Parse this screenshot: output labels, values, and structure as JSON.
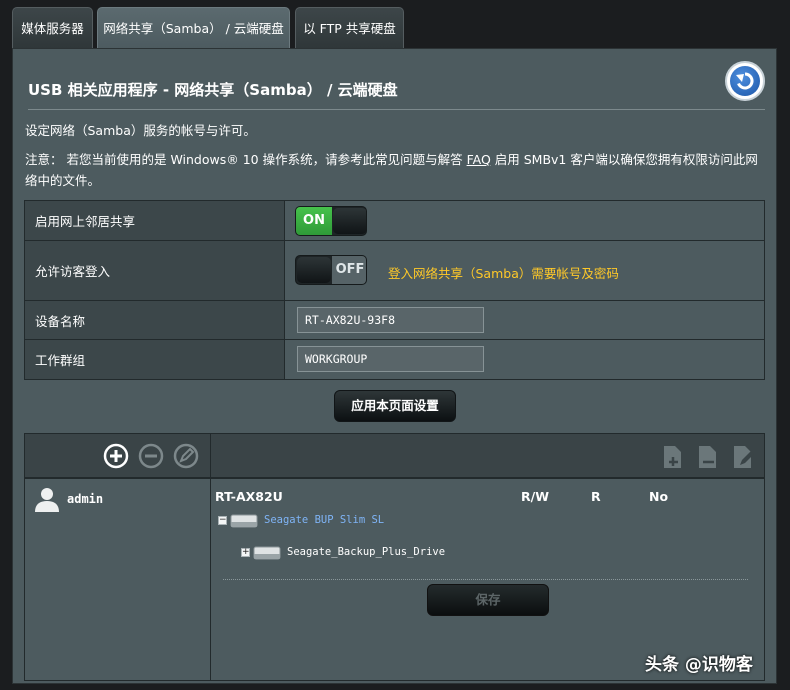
{
  "tabs": [
    {
      "label": "媒体服务器"
    },
    {
      "label": "网络共享（Samba） / 云端硬盘"
    },
    {
      "label": "以 FTP 共享硬盘"
    }
  ],
  "page": {
    "title": "USB 相关应用程序 - 网络共享（Samba） / 云端硬盘",
    "description": "设定网络（Samba）服务的帐号与许可。",
    "note_prefix": "注意： 若您当前使用的是 Windows® 10 操作系统，请参考此常见问题与解答 ",
    "note_faq": "FAQ",
    "note_suffix": " 启用 SMBv1 客户端以确保您拥有权限访问此网络中的文件。"
  },
  "settings": {
    "network_neighborhood": {
      "label": "启用网上邻居共享",
      "toggle": "ON"
    },
    "guest_login": {
      "label": "允许访客登入",
      "toggle": "OFF",
      "hint": "登入网络共享（Samba）需要帐号及密码"
    },
    "device_name": {
      "label": "设备名称",
      "value": "RT-AX82U-93F8"
    },
    "workgroup": {
      "label": "工作群组",
      "value": "WORKGROUP"
    }
  },
  "apply_label": "应用本页面设置",
  "accounts": {
    "users": [
      {
        "name": "admin"
      }
    ],
    "toolbar_icons": [
      "add-icon",
      "remove-icon",
      "edit-icon",
      "add-folder-icon",
      "delete-folder-icon",
      "edit-folder-icon"
    ]
  },
  "shares": {
    "device": "RT-AX82U",
    "columns": [
      "R/W",
      "R",
      "No"
    ],
    "drives": [
      {
        "name": "Seagate BUP Slim SL"
      },
      {
        "name": "Seagate_Backup_Plus_Drive"
      }
    ],
    "save_label": "保存"
  },
  "watermark": "头条 @识物客",
  "colors": {
    "panel": "#4d5b5f",
    "toggle_on": "#3fb845",
    "warning": "#ffc928",
    "link": "#7fb4f6"
  }
}
